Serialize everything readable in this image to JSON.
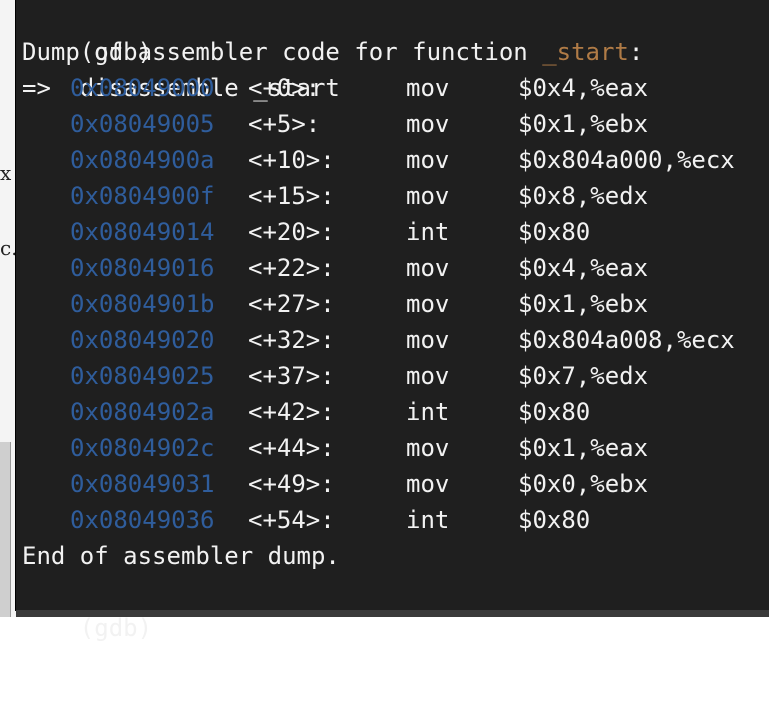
{
  "background": {
    "fragments": [
      "x",
      "c."
    ]
  },
  "terminal": {
    "command_line": {
      "prompt": "(gdb)",
      "command": "disassemble _start"
    },
    "header": {
      "prefix": "Dump of assembler code for function",
      "function": "_start",
      "suffix": ":"
    },
    "current_marker": "=>",
    "instructions": [
      {
        "address": "0x08049000",
        "offset": "<+0>:",
        "mnemonic": "mov",
        "operands": "$0x4,%eax"
      },
      {
        "address": "0x08049005",
        "offset": "<+5>:",
        "mnemonic": "mov",
        "operands": "$0x1,%ebx"
      },
      {
        "address": "0x0804900a",
        "offset": "<+10>:",
        "mnemonic": "mov",
        "operands": "$0x804a000,%ecx"
      },
      {
        "address": "0x0804900f",
        "offset": "<+15>:",
        "mnemonic": "mov",
        "operands": "$0x8,%edx"
      },
      {
        "address": "0x08049014",
        "offset": "<+20>:",
        "mnemonic": "int",
        "operands": "$0x80"
      },
      {
        "address": "0x08049016",
        "offset": "<+22>:",
        "mnemonic": "mov",
        "operands": "$0x4,%eax"
      },
      {
        "address": "0x0804901b",
        "offset": "<+27>:",
        "mnemonic": "mov",
        "operands": "$0x1,%ebx"
      },
      {
        "address": "0x08049020",
        "offset": "<+32>:",
        "mnemonic": "mov",
        "operands": "$0x804a008,%ecx"
      },
      {
        "address": "0x08049025",
        "offset": "<+37>:",
        "mnemonic": "mov",
        "operands": "$0x7,%edx"
      },
      {
        "address": "0x0804902a",
        "offset": "<+42>:",
        "mnemonic": "int",
        "operands": "$0x80"
      },
      {
        "address": "0x0804902c",
        "offset": "<+44>:",
        "mnemonic": "mov",
        "operands": "$0x1,%eax"
      },
      {
        "address": "0x08049031",
        "offset": "<+49>:",
        "mnemonic": "mov",
        "operands": "$0x0,%ebx"
      },
      {
        "address": "0x08049036",
        "offset": "<+54>:",
        "mnemonic": "int",
        "operands": "$0x80"
      }
    ],
    "footer": "End of assembler dump.",
    "final_prompt": "(gdb)"
  },
  "colors": {
    "terminal_background": "#1f1f1f",
    "text": "#f2f2f2",
    "address": "#2f5d9c",
    "function_name": "#b07b46"
  }
}
